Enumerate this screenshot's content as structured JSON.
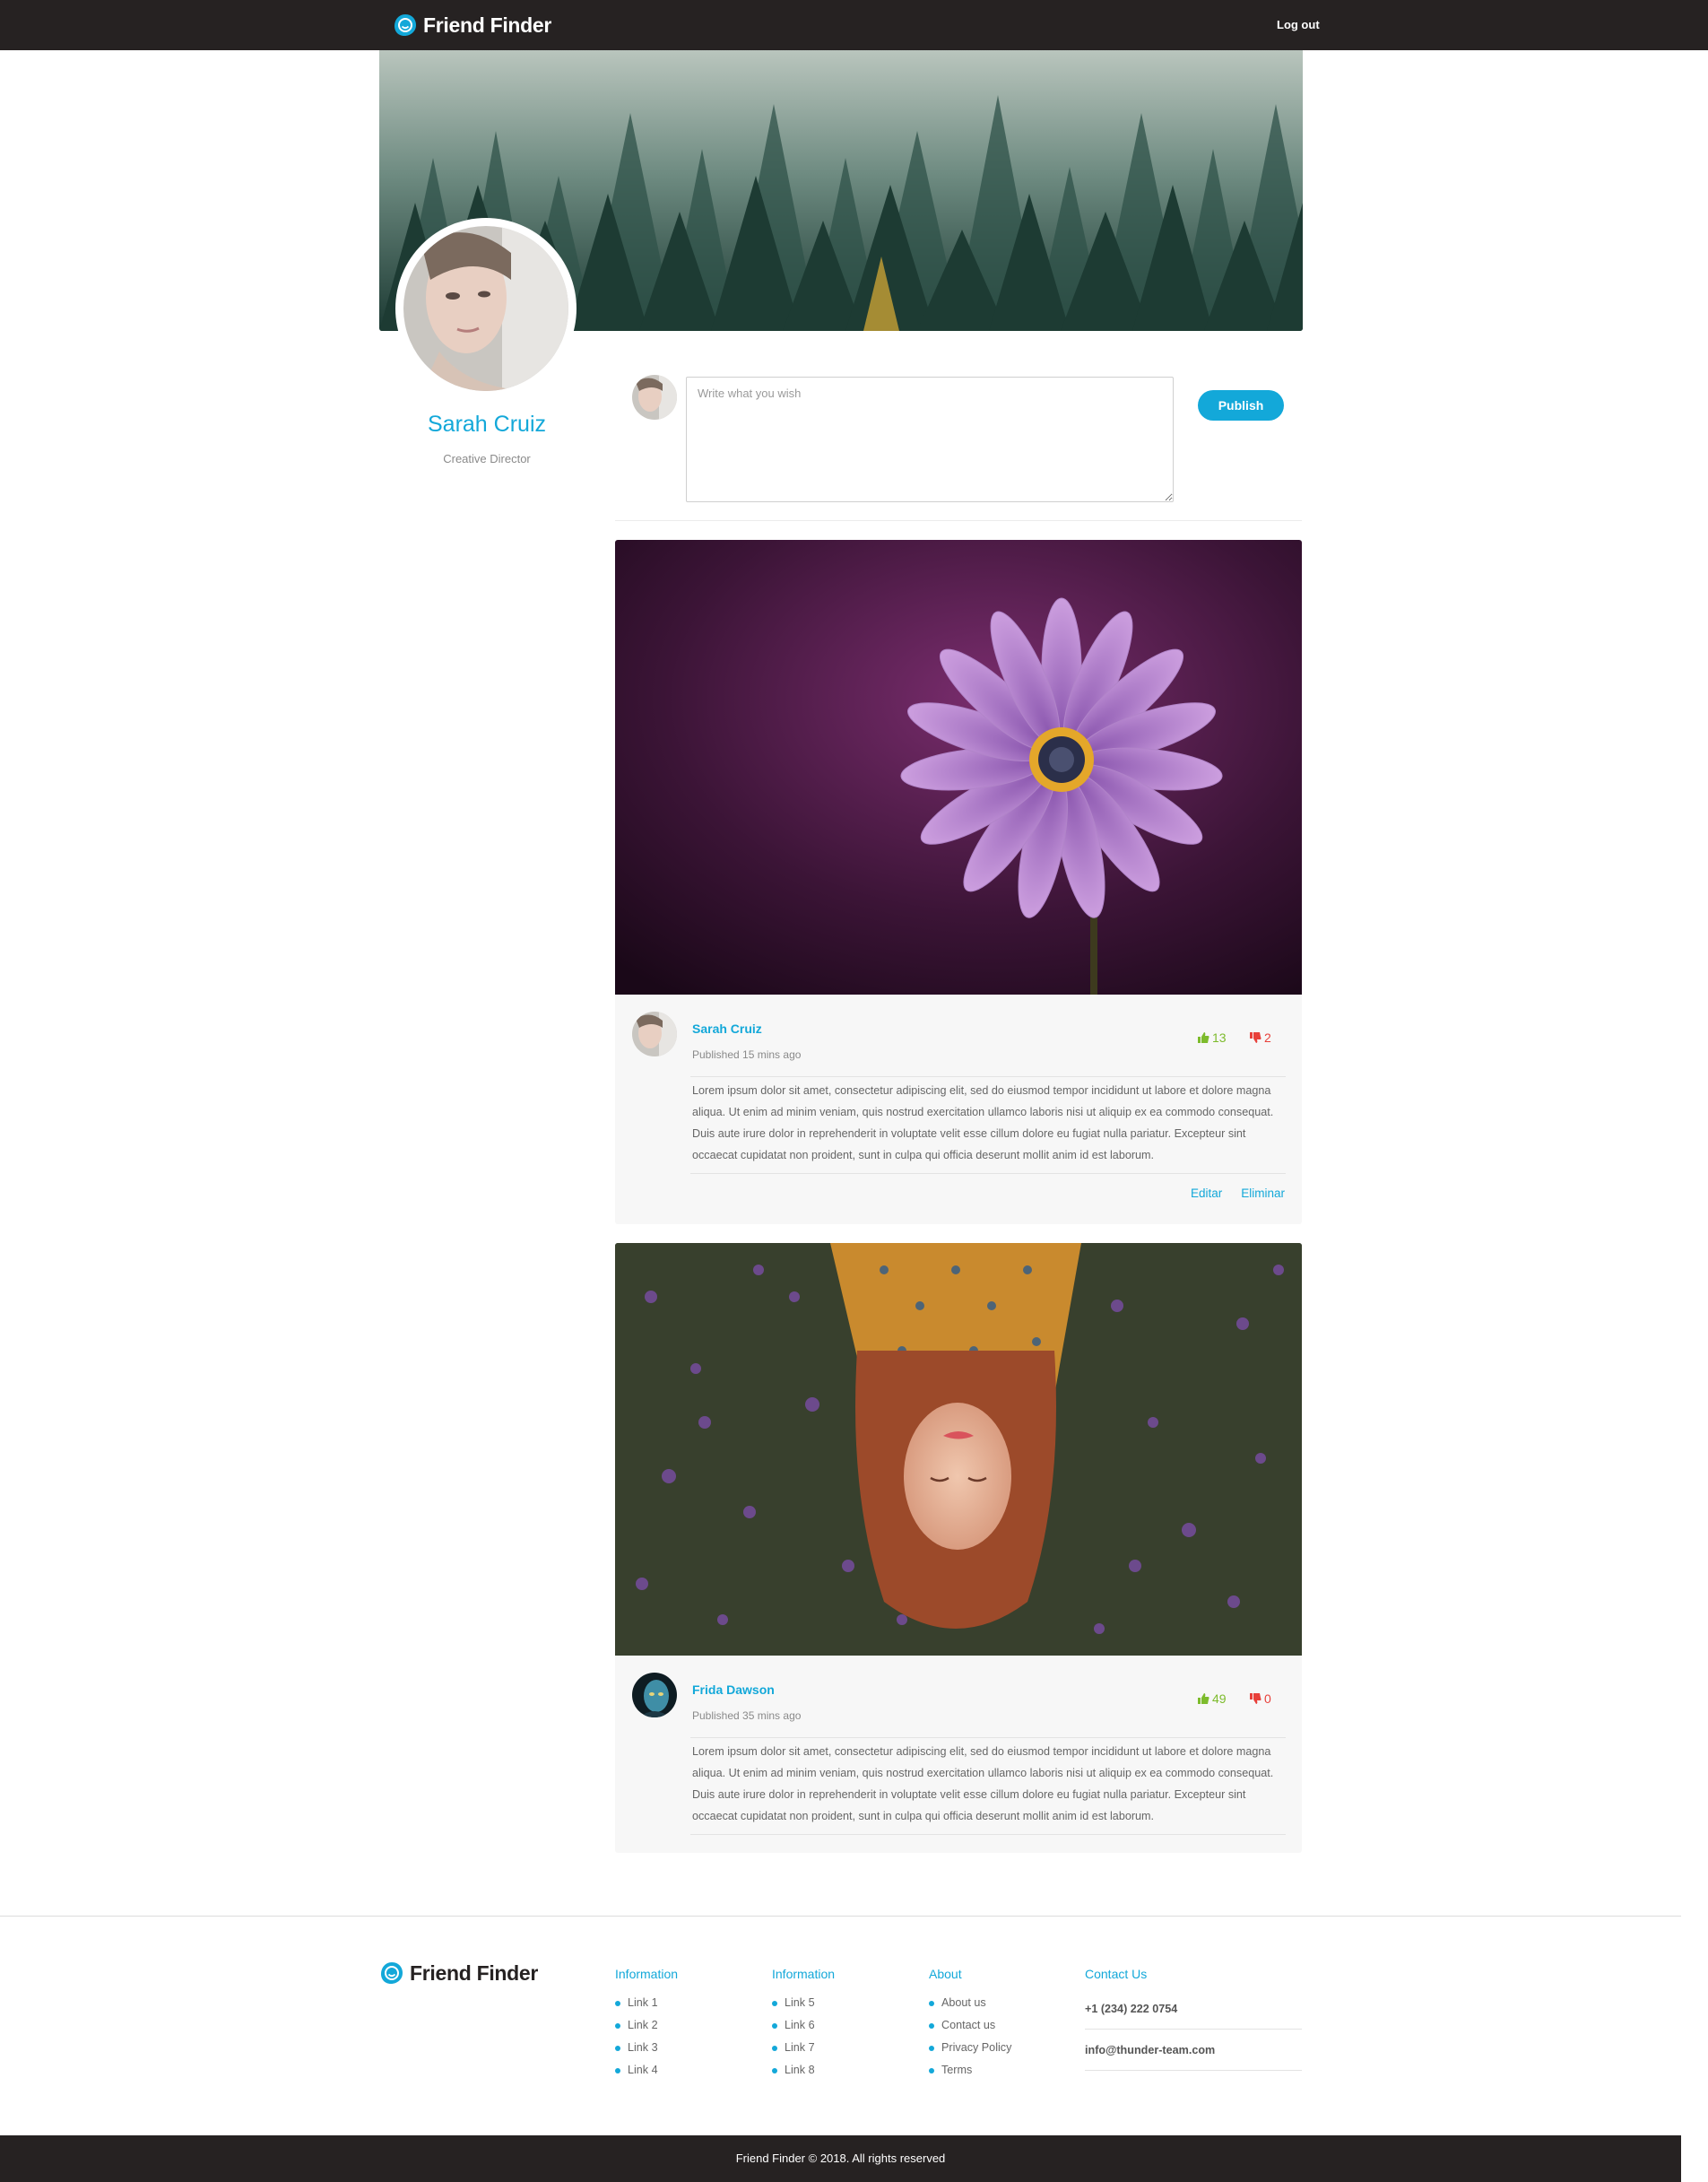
{
  "header": {
    "brand": "Friend Finder",
    "logout_label": "Log out"
  },
  "profile": {
    "name": "Sarah Cruiz",
    "role": "Creative Director"
  },
  "composer": {
    "placeholder": "Write what you wish",
    "publish_label": "Publish"
  },
  "posts": [
    {
      "author": "Sarah Cruiz",
      "time": "Published 15 mins ago",
      "likes": "13",
      "dislikes": "2",
      "body": "Lorem ipsum dolor sit amet, consectetur adipiscing elit, sed do eiusmod tempor incididunt ut labore et dolore magna aliqua. Ut enim ad minim veniam, quis nostrud exercitation ullamco laboris nisi ut aliquip ex ea commodo consequat. Duis aute irure dolor in reprehenderit in voluptate velit esse cillum dolore eu fugiat nulla pariatur. Excepteur sint occaecat cupidatat non proident, sunt in culpa qui officia deserunt mollit anim id est laborum.",
      "edit_label": "Editar",
      "delete_label": "Eliminar"
    },
    {
      "author": "Frida Dawson",
      "time": "Published 35 mins ago",
      "likes": "49",
      "dislikes": "0",
      "body": "Lorem ipsum dolor sit amet, consectetur adipiscing elit, sed do eiusmod tempor incididunt ut labore et dolore magna aliqua. Ut enim ad minim veniam, quis nostrud exercitation ullamco laboris nisi ut aliquip ex ea commodo consequat. Duis aute irure dolor in reprehenderit in voluptate velit esse cillum dolore eu fugiat nulla pariatur. Excepteur sint occaecat cupidatat non proident, sunt in culpa qui officia deserunt mollit anim id est laborum."
    }
  ],
  "footer": {
    "brand": "Friend Finder",
    "columns": [
      {
        "title": "Information",
        "links": [
          "Link 1",
          "Link 2",
          "Link 3",
          "Link 4"
        ]
      },
      {
        "title": "Information",
        "links": [
          "Link 5",
          "Link 6",
          "Link 7",
          "Link 8"
        ]
      },
      {
        "title": "About",
        "links": [
          "About us",
          "Contact us",
          "Privacy Policy",
          "Terms"
        ]
      }
    ],
    "contact": {
      "title": "Contact Us",
      "phone": "+1 (234) 222 0754",
      "email": "info@thunder-team.com"
    },
    "copyright": "Friend Finder © 2018. All rights reserved"
  },
  "colors": {
    "accent": "#13a8d9",
    "nav_bg": "#262222",
    "like": "#7dbb2c",
    "dislike": "#e8403a"
  },
  "icons": [
    "friend-finder-logo-icon",
    "thumbs-up-icon",
    "thumbs-down-icon",
    "bullet-dot-icon"
  ]
}
